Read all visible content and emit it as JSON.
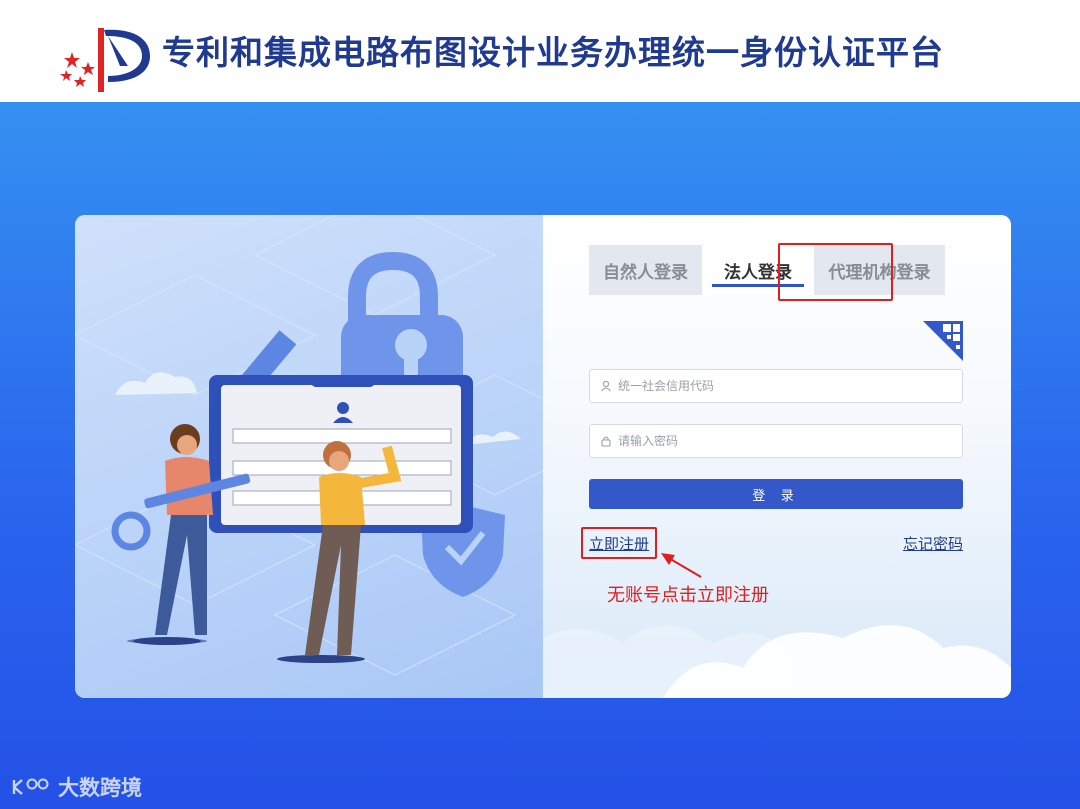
{
  "header": {
    "title": "专利和集成电路布图设计业务办理统一身份认证平台",
    "brand_color": "#1f3a8f"
  },
  "login": {
    "tabs": [
      {
        "label": "自然人登录",
        "active": false
      },
      {
        "label": "法人登录",
        "active": true
      },
      {
        "label": "代理机构登录",
        "active": false
      }
    ],
    "credit_code_placeholder": "统一社会信用代码",
    "password_placeholder": "请输入密码",
    "login_button": "登 录",
    "register_link": "立即注册",
    "forgot_link": "忘记密码",
    "annotation_text": "无账号点击立即注册",
    "qr_icon": "qr-code-icon"
  },
  "watermark": {
    "text": "大数跨境"
  },
  "colors": {
    "accent": "#3457c9",
    "annotation": "#e11d1d",
    "background": "#2f6ff0"
  }
}
